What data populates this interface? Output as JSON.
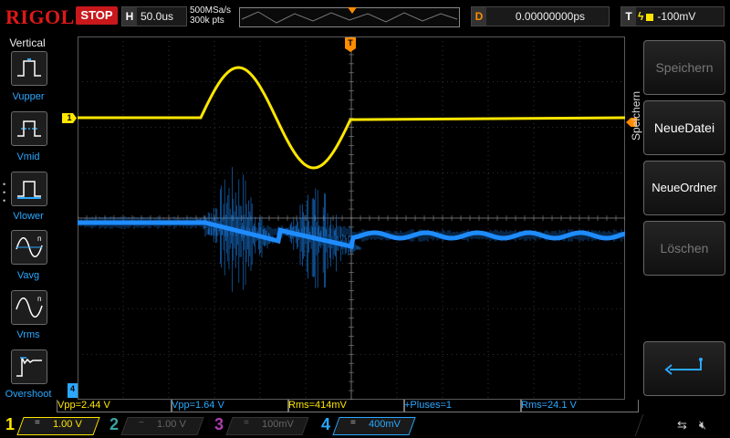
{
  "header": {
    "logo": "RIGOL",
    "run_state": "STOP",
    "timebase_key": "H",
    "timebase": "50.0us",
    "sample_rate": "500MSa/s",
    "memory_depth": "300k pts",
    "delay_key": "D",
    "delay": "0.00000000ps",
    "trigger_key": "T",
    "trigger_level": "-100mV"
  },
  "left_menu": {
    "title": "Vertical",
    "items": [
      {
        "label": "Vupper",
        "icon": "vupper-pulse-icon"
      },
      {
        "label": "Vmid",
        "icon": "vmid-pulse-icon"
      },
      {
        "label": "Vlower",
        "icon": "vlower-pulse-icon"
      },
      {
        "label": "Vavg",
        "icon": "vavg-sine-icon"
      },
      {
        "label": "Vrms",
        "icon": "vrms-sine-icon"
      },
      {
        "label": "Overshoot",
        "icon": "overshoot-icon"
      }
    ]
  },
  "right_menu": {
    "title": "Speichern",
    "buttons": [
      {
        "label": "Speichern",
        "enabled": false
      },
      {
        "label": "NeueDatei",
        "enabled": true
      },
      {
        "label": "NeueOrdner",
        "enabled": true
      },
      {
        "label": "Löschen",
        "enabled": false
      },
      {
        "label": "",
        "icon": "return-arrow-icon",
        "enabled": true
      }
    ]
  },
  "measurements": [
    {
      "text": "Vpp=2.44 V",
      "color": "#ffe600"
    },
    {
      "text": "Vpp=1.64 V",
      "color": "#2aa8ff"
    },
    {
      "text": "Rms=414mV",
      "color": "#ffe600"
    },
    {
      "text": "+Pluses=1",
      "color": "#2aa8ff"
    },
    {
      "text": "Rms=24.1 V",
      "color": "#2aa8ff"
    }
  ],
  "channels": [
    {
      "num": "1",
      "coupling": "=",
      "scale": "1.00 V",
      "color": "#ffe600",
      "active": true
    },
    {
      "num": "2",
      "coupling": "~",
      "scale": "1.00 V",
      "color": "#3aa4a0",
      "active": false
    },
    {
      "num": "3",
      "coupling": "=",
      "scale": "100mV",
      "color": "#b03cb0",
      "active": false
    },
    {
      "num": "4",
      "coupling": "=",
      "scale": "400mV",
      "color": "#2aa8ff",
      "active": true
    }
  ],
  "trace_markers": {
    "ch1": "1",
    "trigger": "T",
    "ch4": "4"
  },
  "colors": {
    "ch1": "#ffe600",
    "ch4": "#1e8cff",
    "grid": "#5a5a5a",
    "trigger": "#ff8c00",
    "logo": "#e01818"
  }
}
